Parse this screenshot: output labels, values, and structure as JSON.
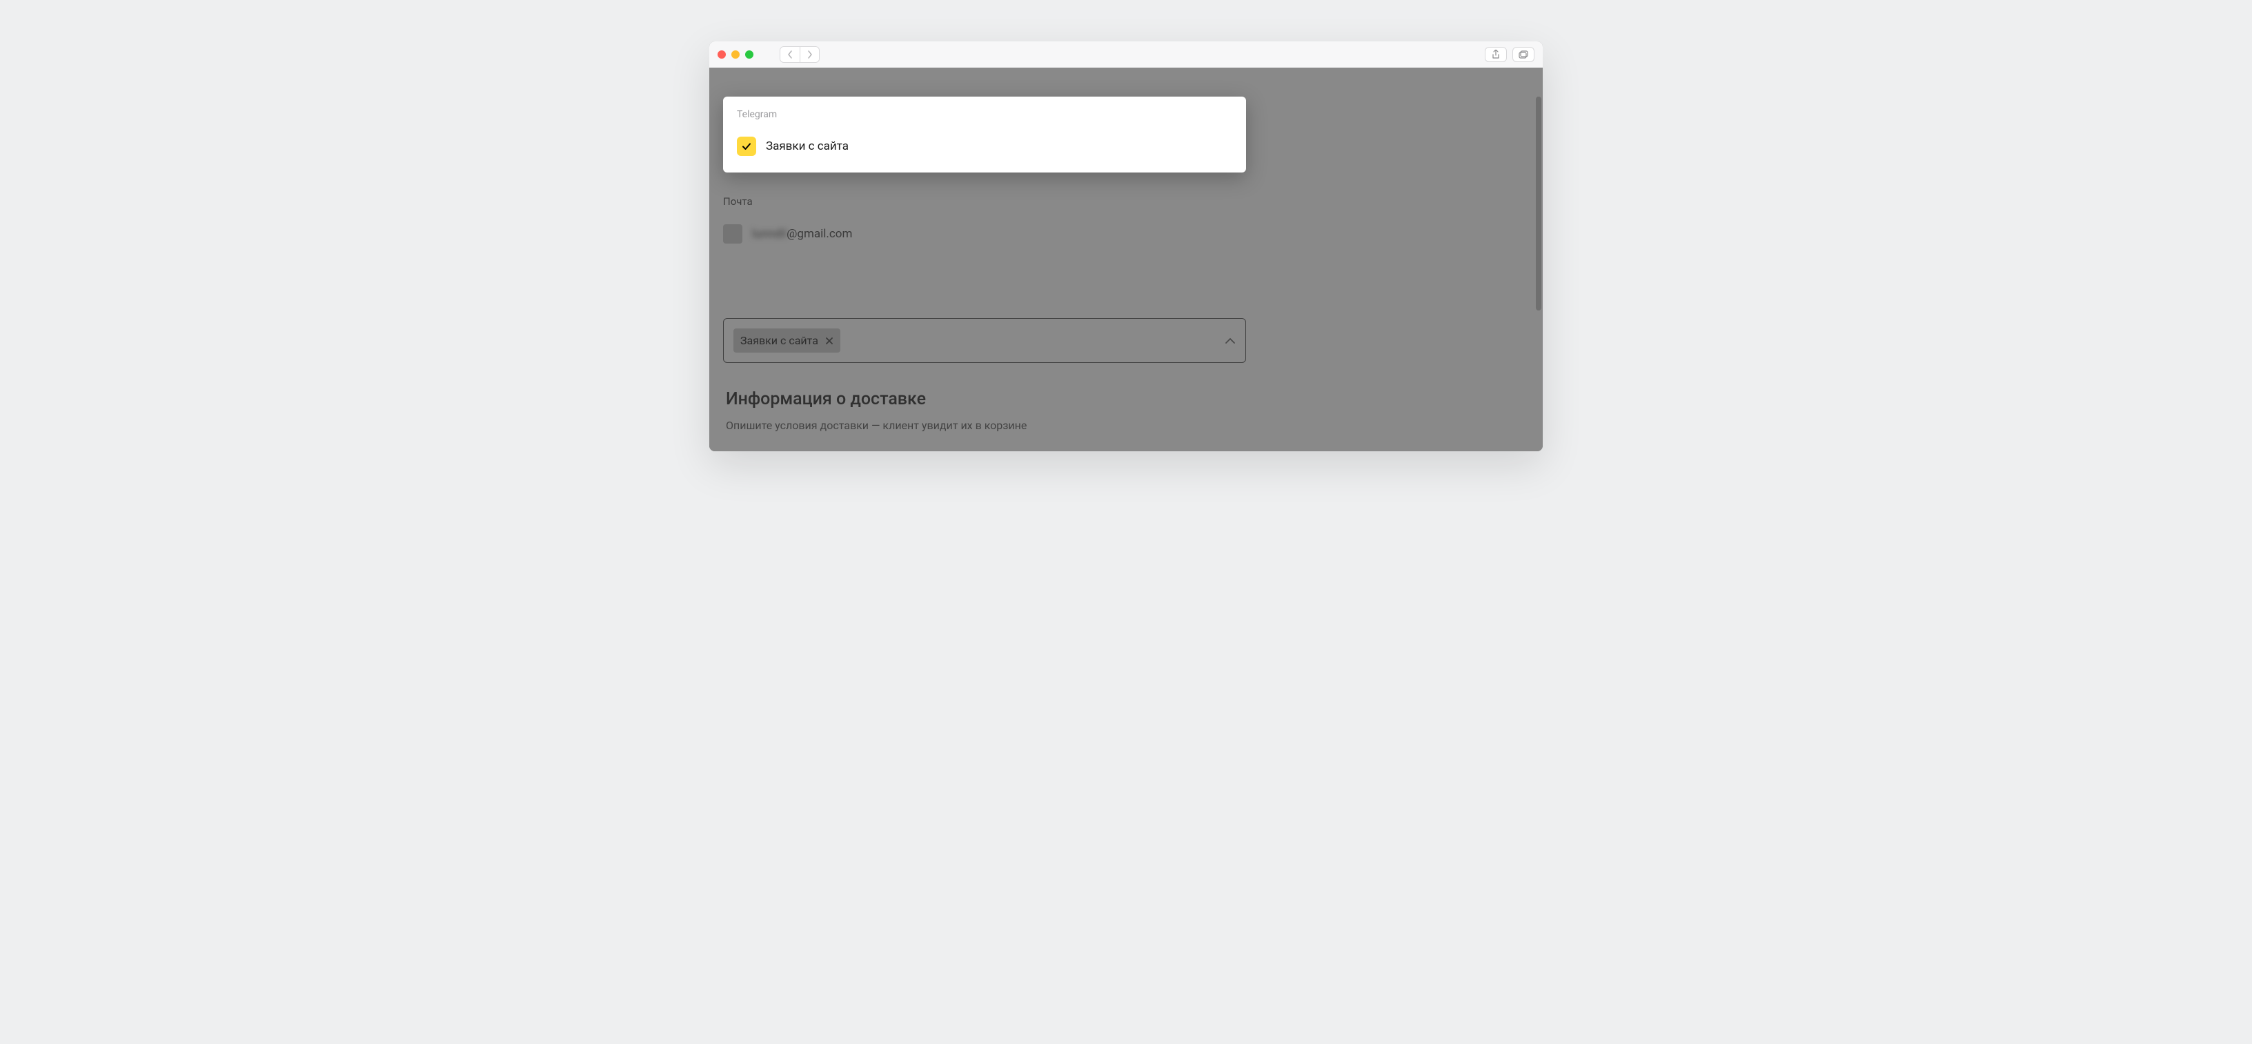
{
  "dropdown": {
    "group1": {
      "label": "Telegram",
      "options": [
        {
          "label": "Заявки с сайта",
          "checked": true
        }
      ]
    }
  },
  "background": {
    "email_section": {
      "label": "Почта",
      "items": [
        {
          "masked_prefix": "lunndil",
          "domain": "@gmail.com",
          "checked": false
        }
      ]
    },
    "select": {
      "tags": [
        {
          "label": "Заявки с сайта"
        }
      ]
    },
    "shipping": {
      "heading": "Информация о доставке",
      "description": "Опишите условия доставки — клиент увидит их в корзине"
    }
  }
}
